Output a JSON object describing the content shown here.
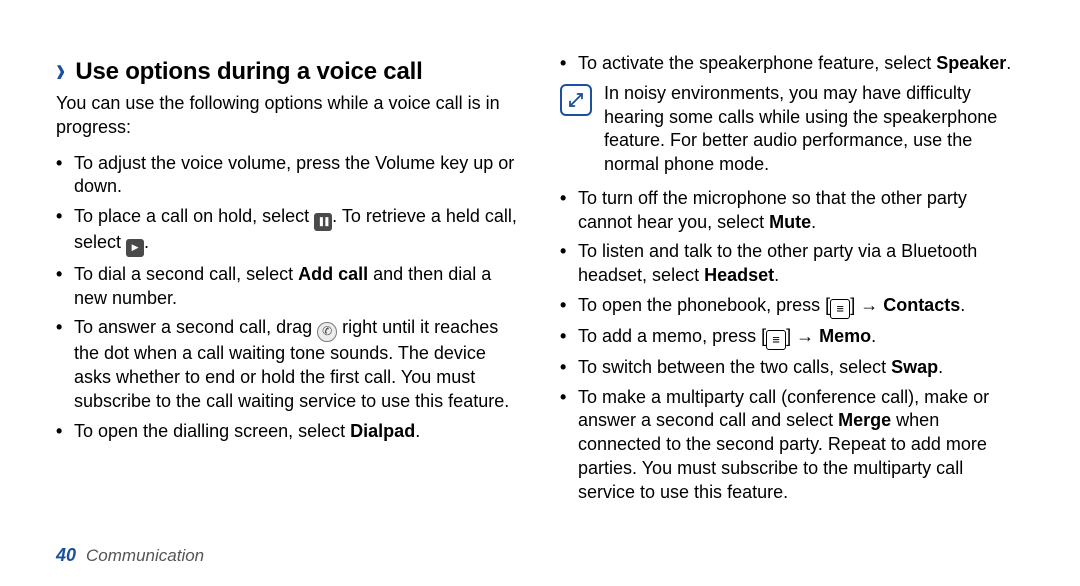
{
  "heading": "Use options during a voice call",
  "intro": "You can use the following options while a voice call is in progress:",
  "left_bullets": [
    {
      "parts": [
        {
          "t": "To adjust the voice volume, press the Volume key up or down."
        }
      ]
    },
    {
      "parts": [
        {
          "t": "To place a call on hold, select "
        },
        {
          "icon": "pause",
          "name": "hold-icon"
        },
        {
          "t": ". To retrieve a held call, select "
        },
        {
          "icon": "play",
          "name": "resume-icon"
        },
        {
          "t": "."
        }
      ]
    },
    {
      "parts": [
        {
          "t": "To dial a second call, select "
        },
        {
          "b": "Add call"
        },
        {
          "t": " and then dial a new number."
        }
      ]
    },
    {
      "parts": [
        {
          "t": "To answer a second call, drag "
        },
        {
          "icon": "phone",
          "name": "call-accept-icon"
        },
        {
          "t": " right until it reaches the dot when a call waiting tone sounds. The device asks whether to end or hold the first call. You must subscribe to the call waiting service to use this feature."
        }
      ]
    },
    {
      "parts": [
        {
          "t": "To open the dialling screen, select "
        },
        {
          "b": "Dialpad"
        },
        {
          "t": "."
        }
      ]
    }
  ],
  "right_top_bullet": {
    "parts": [
      {
        "t": "To activate the speakerphone feature, select "
      },
      {
        "b": "Speaker"
      },
      {
        "t": "."
      }
    ]
  },
  "note": "In noisy environments, you may have difficulty hearing some calls while using the speakerphone feature. For better audio performance, use the normal phone mode.",
  "right_bullets": [
    {
      "parts": [
        {
          "t": "To turn off the microphone so that the other party cannot hear you, select "
        },
        {
          "b": "Mute"
        },
        {
          "t": "."
        }
      ]
    },
    {
      "parts": [
        {
          "t": "To listen and talk to the other party via a Bluetooth headset, select "
        },
        {
          "b": "Headset"
        },
        {
          "t": "."
        }
      ]
    },
    {
      "parts": [
        {
          "t": "To open the phonebook, press ["
        },
        {
          "icon": "menu",
          "name": "menu-icon"
        },
        {
          "t": "] → "
        },
        {
          "b": "Contacts"
        },
        {
          "t": "."
        }
      ]
    },
    {
      "parts": [
        {
          "t": "To add a memo, press ["
        },
        {
          "icon": "menu",
          "name": "menu-icon"
        },
        {
          "t": "] → "
        },
        {
          "b": "Memo"
        },
        {
          "t": "."
        }
      ]
    },
    {
      "parts": [
        {
          "t": "To switch between the two calls, select "
        },
        {
          "b": "Swap"
        },
        {
          "t": "."
        }
      ]
    },
    {
      "parts": [
        {
          "t": "To make a multiparty call (conference call), make or answer a second call and select "
        },
        {
          "b": "Merge"
        },
        {
          "t": " when connected to the second party. Repeat to add more parties. You must subscribe to the multiparty call service to use this feature."
        }
      ]
    }
  ],
  "footer": {
    "page": "40",
    "section": "Communication"
  }
}
